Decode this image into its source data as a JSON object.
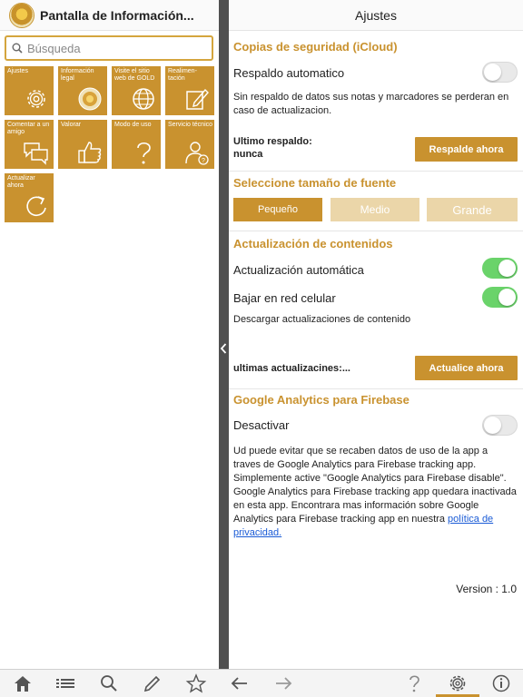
{
  "left": {
    "title": "Pantalla de Información...",
    "search_placeholder": "Búsqueda",
    "tiles": [
      {
        "label": "Ajustes",
        "icon": "gear-icon"
      },
      {
        "label": "Información legal",
        "icon": "seal-icon"
      },
      {
        "label": "Visite el sitio web de GOLD",
        "icon": "globe-icon"
      },
      {
        "label": "Realimen-tación",
        "icon": "edit-icon"
      },
      {
        "label": "Comentar a un amigo",
        "icon": "chat-icon"
      },
      {
        "label": "Valorar",
        "icon": "thumbs-up-icon"
      },
      {
        "label": "Modo de uso",
        "icon": "question-icon"
      },
      {
        "label": "Servicio técnico",
        "icon": "support-person-icon"
      },
      {
        "label": "Actualizar ahora",
        "icon": "refresh-icon"
      }
    ]
  },
  "right": {
    "title": "Ajustes",
    "backup": {
      "heading": "Copias de seguridad (iCloud)",
      "auto_label": "Respaldo automatico",
      "auto_on": false,
      "note": "Sin respaldo de datos sus notas y marcadores se perderan en caso de actualizacion.",
      "last_label": "Ultimo respaldo:",
      "last_value": "nunca",
      "button": "Respalde ahora"
    },
    "font": {
      "heading": "Seleccione tamaño de fuente",
      "options": [
        "Pequeño",
        "Medio",
        "Grande"
      ],
      "selected": "Pequeño"
    },
    "updates": {
      "heading": "Actualización de contenidos",
      "auto_label": "Actualización automática",
      "auto_on": true,
      "cellular_label": "Bajar en red celular",
      "cellular_on": true,
      "download_label": "Descargar actualizaciones de contenido",
      "last_label": "ultimas actualizacines:...",
      "button": "Actualice ahora"
    },
    "analytics": {
      "heading": "Google Analytics para Firebase",
      "disable_label": "Desactivar",
      "disable_on": false,
      "text": "Ud puede evitar que se recaben datos de uso de la app a traves de Google Analytics para Firebase tracking app. Simplemente active \"Google Analytics para Firebase disable\". Google Analytics para Firebase tracking app quedara inactivada en esta app. Encontrara mas información sobre Google Analytics para Firebase tracking app en nuestra ",
      "link": "política de privacidad."
    },
    "version": "Version : 1.0"
  },
  "toolbar": {
    "icons": [
      "home-icon",
      "list-icon",
      "search-icon",
      "pencil-icon",
      "star-icon",
      "back-arrow-icon",
      "forward-arrow-icon",
      "help-icon",
      "settings-icon",
      "info-icon"
    ],
    "active": "settings-icon"
  },
  "colors": {
    "accent": "#c9922f",
    "accent_light": "#ebd6a9",
    "toggle_on": "#6ad36a",
    "divider": "#505050",
    "link": "#1a5bd6"
  }
}
